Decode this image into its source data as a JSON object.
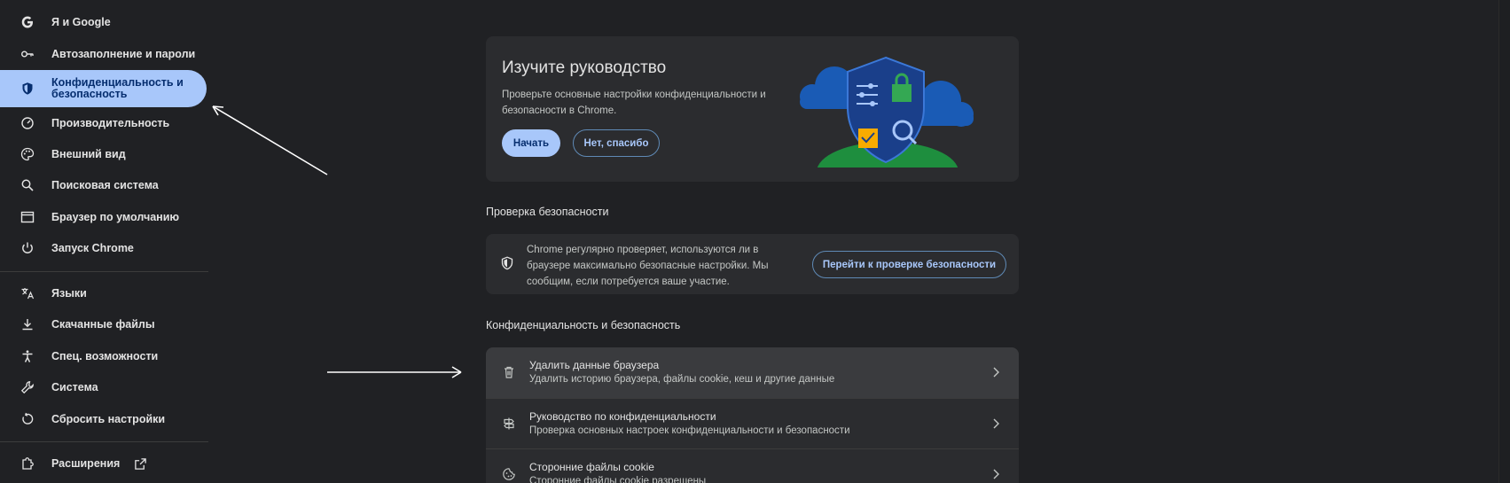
{
  "sidebar": {
    "items": [
      {
        "label": "Я и Google",
        "icon": "google-icon"
      },
      {
        "label": "Автозаполнение и пароли",
        "icon": "key-icon"
      },
      {
        "label": "Конфиденциальность и безопасность",
        "icon": "shield-icon",
        "active": true
      },
      {
        "label": "Производительность",
        "icon": "speedometer-icon"
      },
      {
        "label": "Внешний вид",
        "icon": "palette-icon"
      },
      {
        "label": "Поисковая система",
        "icon": "search-icon"
      },
      {
        "label": "Браузер по умолчанию",
        "icon": "browser-window-icon"
      },
      {
        "label": "Запуск Chrome",
        "icon": "power-icon"
      },
      {
        "label": "Языки",
        "icon": "translate-icon"
      },
      {
        "label": "Скачанные файлы",
        "icon": "download-icon"
      },
      {
        "label": "Спец. возможности",
        "icon": "accessibility-icon"
      },
      {
        "label": "Система",
        "icon": "wrench-icon"
      },
      {
        "label": "Сбросить настройки",
        "icon": "reset-icon"
      },
      {
        "label": "Расширения",
        "icon": "puzzle-icon",
        "trailing_icon": "open-in-new-icon"
      }
    ]
  },
  "guide": {
    "title": "Изучите руководство",
    "description": "Проверьте основные настройки конфиденциальности и безопасности в Chrome.",
    "start_button": "Начать",
    "no_thanks_button": "Нет, спасибо"
  },
  "safety_check": {
    "section_title": "Проверка безопасности",
    "description": "Chrome регулярно проверяет, используются ли в браузере максимально безопасные настройки. Мы сообщим, если потребуется ваше участие.",
    "button": "Перейти к проверке безопасности"
  },
  "privacy": {
    "section_title": "Конфиденциальность и безопасность",
    "rows": [
      {
        "title": "Удалить данные браузера",
        "subtitle": "Удалить историю браузера, файлы cookie, кеш и другие данные",
        "icon": "trash-icon"
      },
      {
        "title": "Руководство по конфиденциальности",
        "subtitle": "Проверка основных настроек конфиденциальности и безопасности",
        "icon": "privacy-guide-icon"
      },
      {
        "title": "Сторонние файлы cookie",
        "subtitle": "Сторонние файлы cookie разрешены",
        "icon": "cookie-icon"
      }
    ]
  },
  "colors": {
    "background": "#202124",
    "accent": "#a8c7fa",
    "card": "#2b2c2f"
  }
}
